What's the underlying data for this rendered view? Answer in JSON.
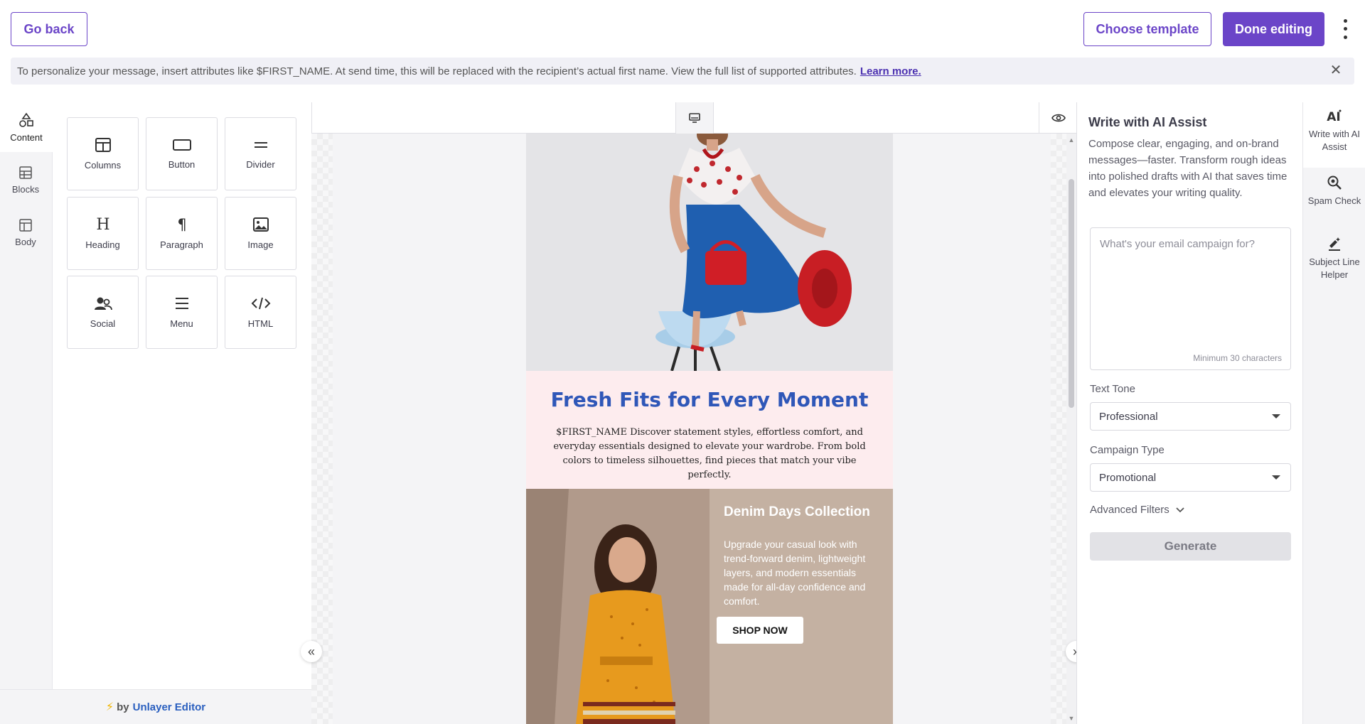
{
  "topbar": {
    "go_back": "Go back",
    "choose_template": "Choose template",
    "done_editing": "Done editing"
  },
  "banner": {
    "text": "To personalize your message, insert attributes like $FIRST_NAME. At send time, this will be replaced with the recipient’s actual first name. View the full list of supported attributes.",
    "link": "Learn more.",
    "close_icon": "close-icon"
  },
  "left_rail": {
    "items": [
      {
        "label": "Content",
        "icon": "shapes-icon"
      },
      {
        "label": "Blocks",
        "icon": "blocks-icon"
      },
      {
        "label": "Body",
        "icon": "body-icon"
      }
    ]
  },
  "tiles": [
    {
      "label": "Columns",
      "icon": "columns-icon"
    },
    {
      "label": "Button",
      "icon": "button-icon"
    },
    {
      "label": "Divider",
      "icon": "divider-icon"
    },
    {
      "label": "Heading",
      "icon": "heading-icon"
    },
    {
      "label": "Paragraph",
      "icon": "paragraph-icon"
    },
    {
      "label": "Image",
      "icon": "image-icon"
    },
    {
      "label": "Social",
      "icon": "social-icon"
    },
    {
      "label": "Menu",
      "icon": "menu-icon"
    },
    {
      "label": "HTML",
      "icon": "code-icon"
    }
  ],
  "footer": {
    "by": "by",
    "brand": "Unlayer Editor"
  },
  "email": {
    "hero_title": "Fresh Fits for Every Moment",
    "hero_text": "$FIRST_NAME Discover statement styles, effortless comfort, and everyday essentials designed to elevate your wardrobe. From bold colors to timeless silhouettes, find pieces that match your vibe perfectly.",
    "denim_title": "Denim Days Collection",
    "denim_text": "Upgrade your casual look with trend-forward denim, lightweight layers, and modern essentials made for all-day confidence and comfort.",
    "shop_button": "SHOP NOW"
  },
  "ai_panel": {
    "title": "Write with AI Assist",
    "description": "Compose clear, engaging, and on-brand messages—faster. Transform rough ideas into polished drafts with AI that saves time and elevates your writing quality.",
    "placeholder": "What's your email campaign for?",
    "min_chars": "Minimum 30 characters",
    "tone_label": "Text Tone",
    "tone_value": "Professional",
    "campaign_label": "Campaign Type",
    "campaign_value": "Promotional",
    "advanced_filters": "Advanced Filters",
    "generate": "Generate"
  },
  "right_rail": {
    "items": [
      {
        "label": "Write with AI Assist",
        "icon": "ai-icon"
      },
      {
        "label": "Spam Check",
        "icon": "spam-check-icon"
      },
      {
        "label": "Subject Line Helper",
        "icon": "subject-helper-icon"
      }
    ]
  },
  "colors": {
    "accent": "#6b45c8",
    "hero_title": "#2f57b8",
    "hero_bg": "#fdecee",
    "denim_bg": "#c4b1a2"
  }
}
